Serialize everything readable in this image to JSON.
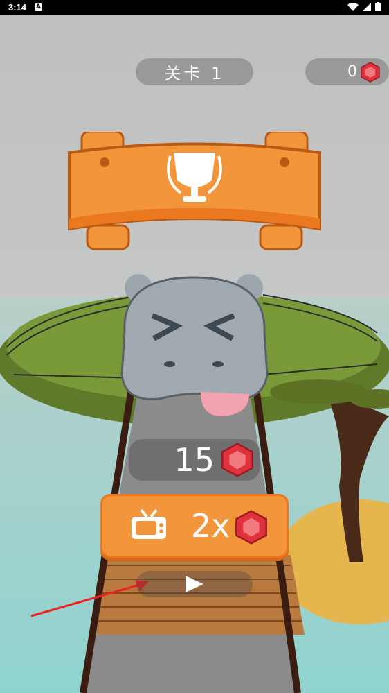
{
  "status_bar": {
    "time": "3:14",
    "notification_icon": "A"
  },
  "hud": {
    "level_label": "关卡 1",
    "gem_count": "0"
  },
  "reward": {
    "amount": "15"
  },
  "ad_button": {
    "multiplier": "2x",
    "icon": "tv-icon"
  },
  "continue_button": {
    "icon": "play-icon"
  },
  "colors": {
    "orange": "#f3953a",
    "orange_dark": "#e9781f",
    "gem_red": "#e0323c"
  }
}
